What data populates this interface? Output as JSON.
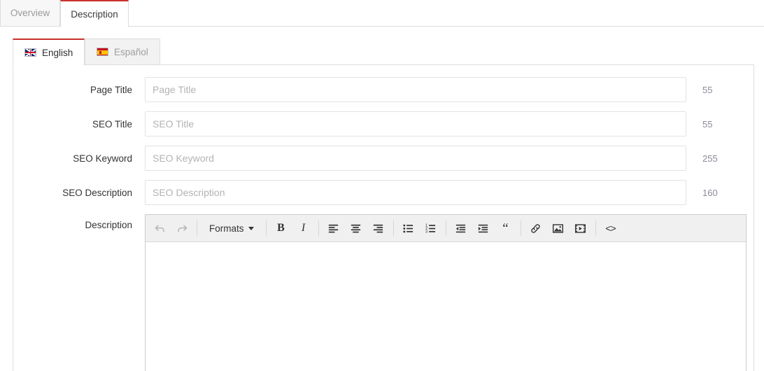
{
  "top_tabs": [
    {
      "label": "Overview",
      "active": false
    },
    {
      "label": "Description",
      "active": true
    }
  ],
  "language_tabs": [
    {
      "label": "English",
      "flag": "flag-uk-icon",
      "active": true
    },
    {
      "label": "Español",
      "flag": "flag-es-icon",
      "active": false
    }
  ],
  "form": {
    "fields": [
      {
        "label": "Page Title",
        "value": "",
        "placeholder": "Page Title",
        "counter": "55"
      },
      {
        "label": "SEO Title",
        "value": "",
        "placeholder": "SEO Title",
        "counter": "55"
      },
      {
        "label": "SEO Keyword",
        "value": "",
        "placeholder": "SEO Keyword",
        "counter": "255"
      },
      {
        "label": "SEO Description",
        "value": "",
        "placeholder": "SEO Description",
        "counter": "160"
      }
    ],
    "description": {
      "label": "Description",
      "body_text": ""
    }
  },
  "editor_toolbar": {
    "formats_label": "Formats",
    "buttons": [
      {
        "name": "undo-icon",
        "title": "Undo",
        "disabled": true
      },
      {
        "name": "redo-icon",
        "title": "Redo",
        "disabled": true
      },
      {
        "name": "bold-icon",
        "title": "Bold",
        "glyph": "B"
      },
      {
        "name": "italic-icon",
        "title": "Italic",
        "glyph": "I"
      },
      {
        "name": "align-left-icon",
        "title": "Align left"
      },
      {
        "name": "align-center-icon",
        "title": "Align center"
      },
      {
        "name": "align-right-icon",
        "title": "Align right"
      },
      {
        "name": "bullet-list-icon",
        "title": "Bullet list"
      },
      {
        "name": "numbered-list-icon",
        "title": "Numbered list"
      },
      {
        "name": "outdent-icon",
        "title": "Decrease indent"
      },
      {
        "name": "indent-icon",
        "title": "Increase indent"
      },
      {
        "name": "blockquote-icon",
        "title": "Blockquote",
        "glyph": "“"
      },
      {
        "name": "link-icon",
        "title": "Insert/edit link"
      },
      {
        "name": "image-icon",
        "title": "Insert/edit image"
      },
      {
        "name": "media-icon",
        "title": "Insert/edit media"
      },
      {
        "name": "source-code-icon",
        "title": "Source code",
        "glyph": "<>"
      }
    ]
  },
  "colors": {
    "accent": "#c9302c",
    "border": "#dddddd",
    "toolbar_bg": "#f0f0f0",
    "placeholder": "#b3b3b3",
    "counter_text": "#8a8a98"
  }
}
